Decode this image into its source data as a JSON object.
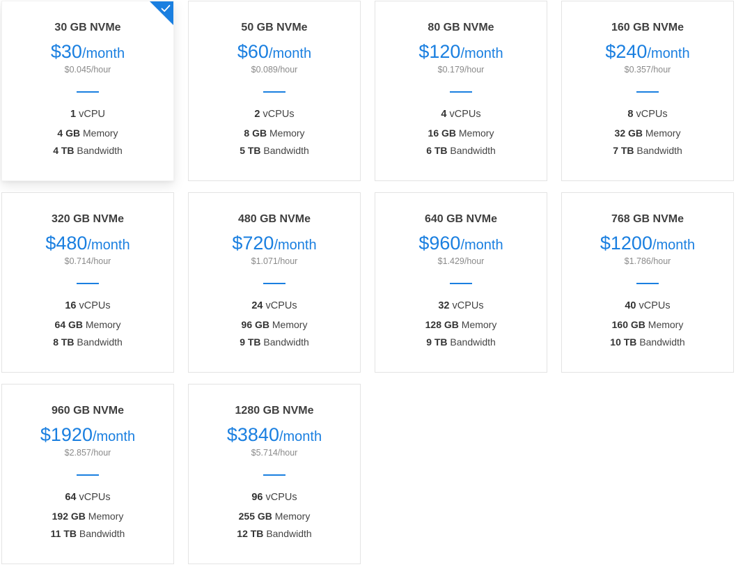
{
  "plans": [
    {
      "name": "30 GB NVMe",
      "price": "$30",
      "period": "/month",
      "hourly": "$0.045/hour",
      "cpu_count": "1",
      "cpu_unit": "vCPU",
      "mem_value": "4 GB",
      "mem_unit": "Memory",
      "bw_value": "4 TB",
      "bw_unit": "Bandwidth",
      "selected": true
    },
    {
      "name": "50 GB NVMe",
      "price": "$60",
      "period": "/month",
      "hourly": "$0.089/hour",
      "cpu_count": "2",
      "cpu_unit": "vCPUs",
      "mem_value": "8 GB",
      "mem_unit": "Memory",
      "bw_value": "5 TB",
      "bw_unit": "Bandwidth",
      "selected": false
    },
    {
      "name": "80 GB NVMe",
      "price": "$120",
      "period": "/month",
      "hourly": "$0.179/hour",
      "cpu_count": "4",
      "cpu_unit": "vCPUs",
      "mem_value": "16 GB",
      "mem_unit": "Memory",
      "bw_value": "6 TB",
      "bw_unit": "Bandwidth",
      "selected": false
    },
    {
      "name": "160 GB NVMe",
      "price": "$240",
      "period": "/month",
      "hourly": "$0.357/hour",
      "cpu_count": "8",
      "cpu_unit": "vCPUs",
      "mem_value": "32 GB",
      "mem_unit": "Memory",
      "bw_value": "7 TB",
      "bw_unit": "Bandwidth",
      "selected": false
    },
    {
      "name": "320 GB NVMe",
      "price": "$480",
      "period": "/month",
      "hourly": "$0.714/hour",
      "cpu_count": "16",
      "cpu_unit": "vCPUs",
      "mem_value": "64 GB",
      "mem_unit": "Memory",
      "bw_value": "8 TB",
      "bw_unit": "Bandwidth",
      "selected": false
    },
    {
      "name": "480 GB NVMe",
      "price": "$720",
      "period": "/month",
      "hourly": "$1.071/hour",
      "cpu_count": "24",
      "cpu_unit": "vCPUs",
      "mem_value": "96 GB",
      "mem_unit": "Memory",
      "bw_value": "9 TB",
      "bw_unit": "Bandwidth",
      "selected": false
    },
    {
      "name": "640 GB NVMe",
      "price": "$960",
      "period": "/month",
      "hourly": "$1.429/hour",
      "cpu_count": "32",
      "cpu_unit": "vCPUs",
      "mem_value": "128 GB",
      "mem_unit": "Memory",
      "bw_value": "9 TB",
      "bw_unit": "Bandwidth",
      "selected": false
    },
    {
      "name": "768 GB NVMe",
      "price": "$1200",
      "period": "/month",
      "hourly": "$1.786/hour",
      "cpu_count": "40",
      "cpu_unit": "vCPUs",
      "mem_value": "160 GB",
      "mem_unit": "Memory",
      "bw_value": "10 TB",
      "bw_unit": "Bandwidth",
      "selected": false
    },
    {
      "name": "960 GB NVMe",
      "price": "$1920",
      "period": "/month",
      "hourly": "$2.857/hour",
      "cpu_count": "64",
      "cpu_unit": "vCPUs",
      "mem_value": "192 GB",
      "mem_unit": "Memory",
      "bw_value": "11 TB",
      "bw_unit": "Bandwidth",
      "selected": false
    },
    {
      "name": "1280 GB NVMe",
      "price": "$3840",
      "period": "/month",
      "hourly": "$5.714/hour",
      "cpu_count": "96",
      "cpu_unit": "vCPUs",
      "mem_value": "255 GB",
      "mem_unit": "Memory",
      "bw_value": "12 TB",
      "bw_unit": "Bandwidth",
      "selected": false
    }
  ],
  "colors": {
    "accent": "#1a7fe0",
    "text": "#3f3f3f",
    "muted": "#8a8a8a",
    "border": "#e3e3e3"
  },
  "icons": {
    "selected_marker": "checkmark-icon"
  }
}
